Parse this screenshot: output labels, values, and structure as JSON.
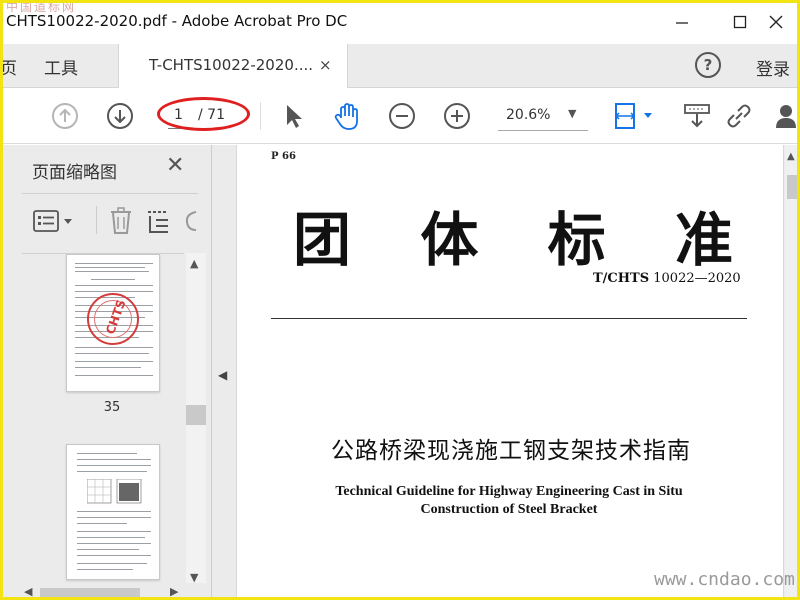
{
  "window": {
    "title": "CHTS10022-2020.pdf - Adobe Acrobat Pro DC",
    "watermark_top": "中国道标网"
  },
  "tabs": {
    "partial_label": "页",
    "tools_label": "工具",
    "doc_tab_label": "T-CHTS10022-2020....",
    "doc_tab_close": "×",
    "help_label": "?",
    "login_label": "登录"
  },
  "toolbar": {
    "current_page": "1",
    "total_pages": "/ 71",
    "zoom": "20.6%",
    "zoom_caret": "▼"
  },
  "sidebar": {
    "title": "页面缩略图",
    "close": "✕",
    "thumb1_label": "35",
    "stamp_text": "CHTS"
  },
  "document": {
    "header_code": "P 66",
    "title_chars": [
      "团",
      "体",
      "标",
      "准"
    ],
    "std_prefix": "T/CHTS",
    "std_number": " 10022—2020",
    "cn_name": "公路桥梁现浇施工钢支架技术指南",
    "en_name_line1": "Technical Guideline for Highway Engineering Cast in Situ",
    "en_name_line2": "Construction of Steel Bracket"
  },
  "footer": {
    "watermark": "www.cndao.com"
  },
  "colors": {
    "frame": "#f2e312",
    "annotation": "#e02020",
    "hand_tool": "#1473e6"
  }
}
